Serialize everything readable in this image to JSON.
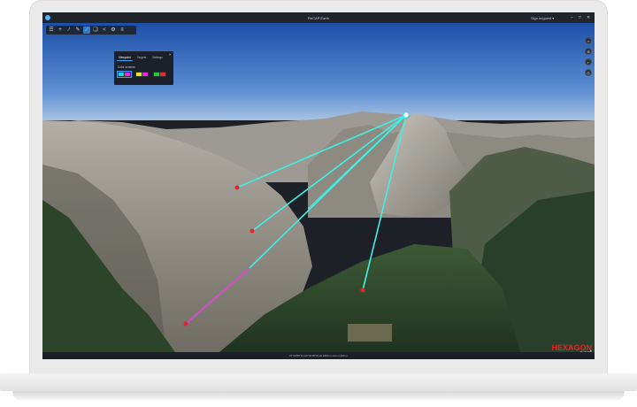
{
  "window": {
    "title": "ReCAP Earth",
    "signin_text": "Sign in/guest ▾",
    "controls": {
      "minimize": "–",
      "maximize": "□",
      "close": "✕"
    }
  },
  "toolbar": {
    "tools": [
      {
        "name": "layers-icon",
        "glyph": "☰"
      },
      {
        "name": "add-icon",
        "glyph": "+"
      },
      {
        "name": "line-measure-icon",
        "glyph": "∕"
      },
      {
        "name": "pencil-icon",
        "glyph": "✎"
      },
      {
        "name": "line-of-sight-icon",
        "glyph": "⟋"
      },
      {
        "name": "bookmark-icon",
        "glyph": "❏"
      },
      {
        "name": "share-icon",
        "glyph": "<"
      },
      {
        "name": "settings-icon",
        "glyph": "⚙"
      },
      {
        "name": "menu-icon",
        "glyph": "≡"
      }
    ],
    "active_index": 4
  },
  "nav_controls": [
    {
      "name": "search-icon",
      "glyph": "⌕"
    },
    {
      "name": "compass-icon",
      "glyph": "⊕"
    },
    {
      "name": "zoom-icon",
      "glyph": "◐"
    },
    {
      "name": "globe-icon",
      "glyph": "◎"
    }
  ],
  "panel": {
    "tabs": [
      "Viewpoint",
      "Targets",
      "Settings"
    ],
    "active_tab": 0,
    "close": "✕",
    "color_label": "Color scheme",
    "swatches": [
      {
        "colors": [
          "#19d2e6",
          "#e92ad8"
        ],
        "selected": true
      },
      {
        "colors": [
          "#e3e82c",
          "#e92ad8"
        ],
        "selected": false
      },
      {
        "colors": [
          "#1fcf3c",
          "#e53030"
        ],
        "selected": false
      }
    ]
  },
  "colors": {
    "visible_line": "#3ff0e6",
    "hidden_line": "#e444d6",
    "target_point": "#e3262e",
    "observer_point": "#ffffff"
  },
  "statusbar": {
    "text": "37°43'55\"N 119°32'38\"W  alt 1880 m  cam 2,100 m"
  },
  "brand": {
    "name1": "HEXAGON",
    "name2": "esri"
  }
}
